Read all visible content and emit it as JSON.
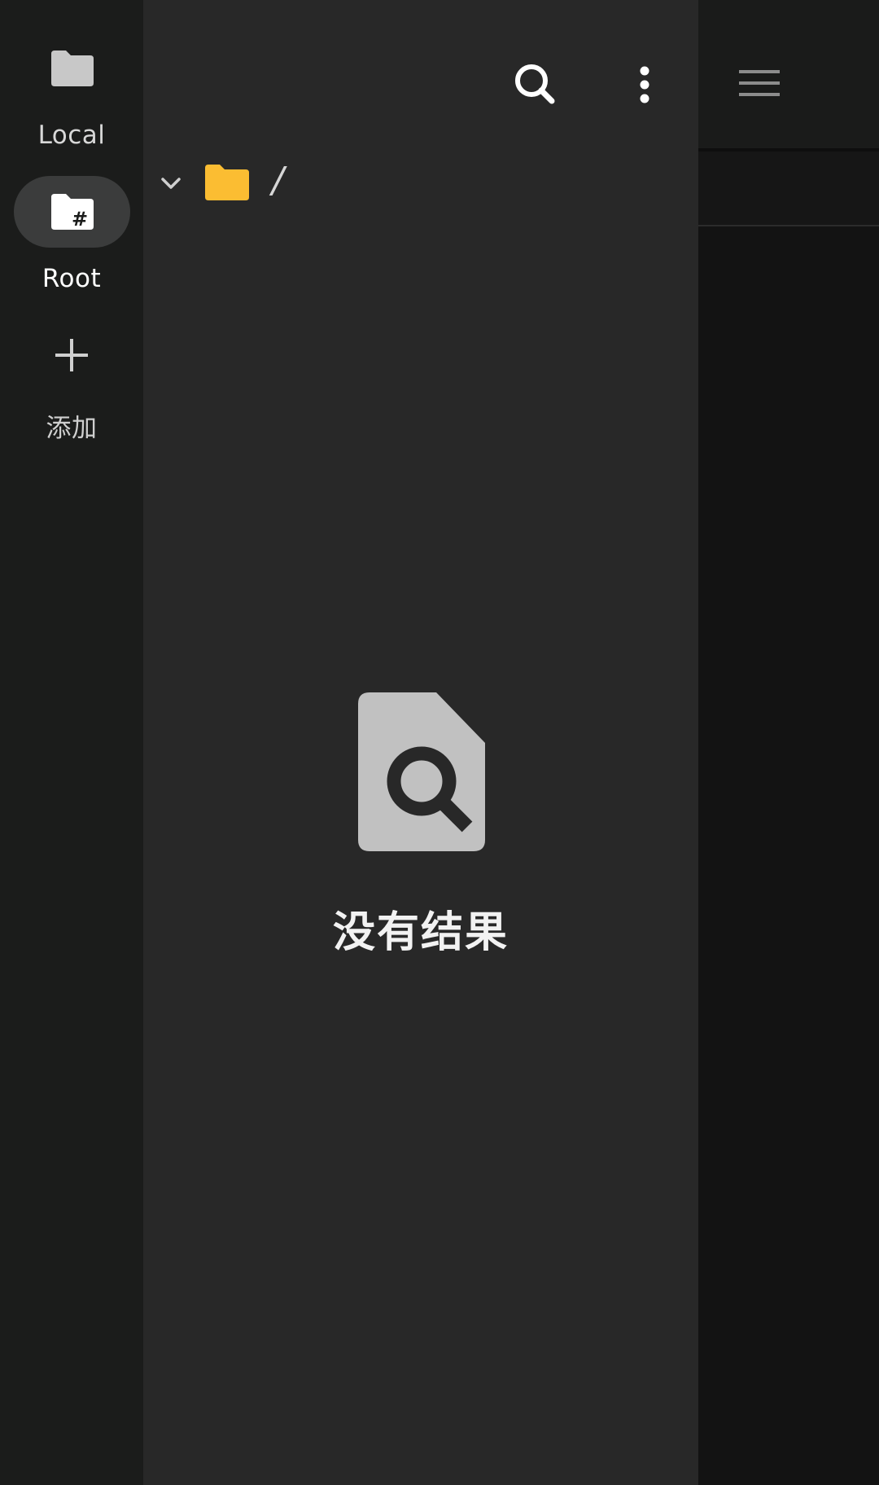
{
  "rail": {
    "items": [
      {
        "label": "Local",
        "icon": "folder-icon",
        "active": false
      },
      {
        "label": "Root",
        "icon": "folder-hash-icon",
        "active": true
      },
      {
        "label": "添加",
        "icon": "plus-icon",
        "active": false
      }
    ]
  },
  "drawer": {
    "toolbar": {
      "search_icon": "search-icon",
      "menu_icon": "more-vert-icon"
    },
    "path": {
      "text": "/",
      "expand_icon": "chevron-down-icon",
      "folder_icon": "folder-icon",
      "folder_color": "#fbbd32"
    },
    "empty_state": {
      "icon": "file-search-icon",
      "label": "没有结果"
    }
  },
  "background_app": {
    "menu_icon": "hamburger-menu-icon"
  },
  "colors": {
    "rail_bg": "#1b1c1b",
    "drawer_bg": "#282828",
    "active_pill": "#3b3c3c",
    "accent_folder": "#fbbd32"
  }
}
